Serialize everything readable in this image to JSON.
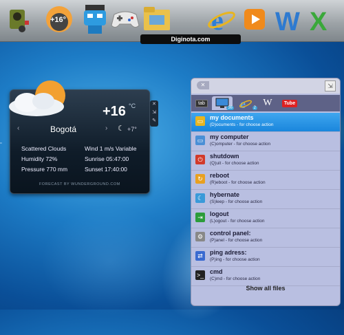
{
  "dock": {
    "label": "Diginota.com",
    "weather_temp": "+16°",
    "items": [
      "speaker-robot-icon",
      "weather-sun-icon",
      "blue-robot-icon",
      "gamepad-icon",
      "folder-icon",
      "internet-explorer-icon",
      "media-player-icon",
      "word-icon",
      "excel-icon"
    ]
  },
  "weather": {
    "temp": "+16",
    "unit": "°C",
    "city": "Bogotá",
    "low": "+7°",
    "condition": "Scattered Clouds",
    "wind": "Wind   1 m/s Variable",
    "humidity": "Humidity 72%",
    "sunrise": "Sunrise 05:47:00",
    "pressure": "Pressure  770 mm",
    "sunset": "Sunset 17:40:00",
    "footer": "FORECAST BY WUNDERGROUND.COM"
  },
  "panel": {
    "tabs": [
      {
        "label": "tab"
      },
      {
        "label": "computer",
        "badge": "36"
      },
      {
        "label": "ie",
        "badge": "2"
      },
      {
        "label": "W"
      },
      {
        "label": "Tube"
      }
    ],
    "items": [
      {
        "title": "my documents",
        "sub": "(D)ocuments - for choose action",
        "color": "#e8b520"
      },
      {
        "title": "my computer",
        "sub": "(C)omputer - for choose action",
        "color": "#4a8fd6"
      },
      {
        "title": "shutdown",
        "sub": "(Q)uit - for choose action",
        "color": "#d23a2a"
      },
      {
        "title": "reboot",
        "sub": "(R)eboot - for choose action",
        "color": "#e8a020"
      },
      {
        "title": "hybernate",
        "sub": "(S)leep - for choose action",
        "color": "#3a9ad9"
      },
      {
        "title": "logout",
        "sub": "(L)ogout - for choose action",
        "color": "#2c9c3a"
      },
      {
        "title": "control panel:",
        "sub": "(P)anel - for choose action",
        "color": "#888"
      },
      {
        "title": "ping adress:",
        "sub": "(P)ing - for choose action",
        "color": "#3a6ad0"
      },
      {
        "title": "cmd",
        "sub": "(C)md - for choose action",
        "color": "#222"
      }
    ],
    "show_all": "Show all files"
  }
}
